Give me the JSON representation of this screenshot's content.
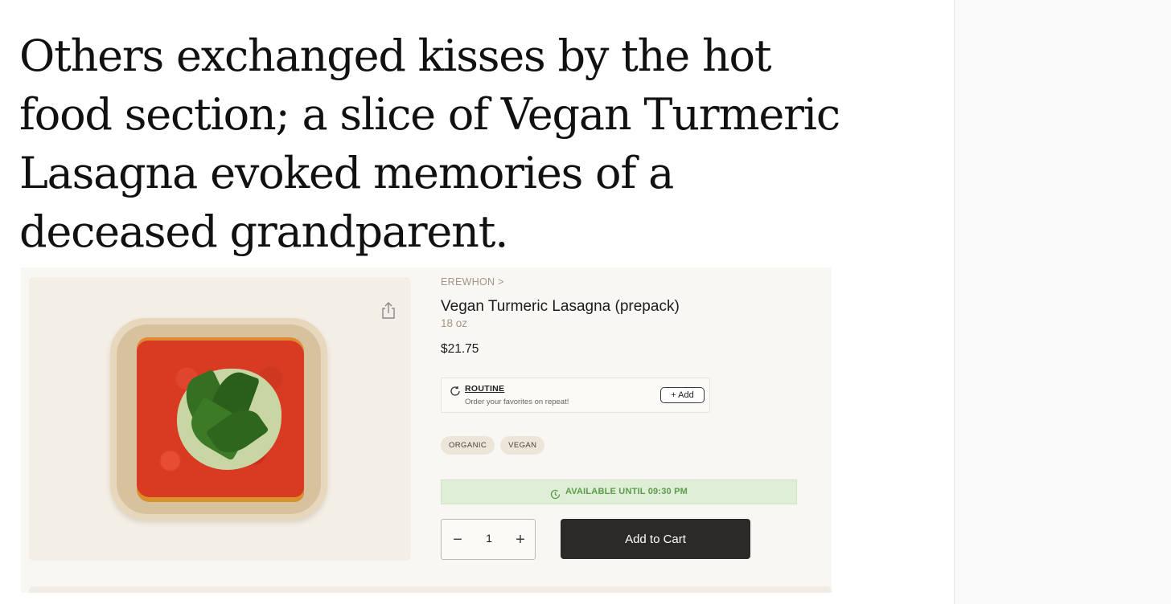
{
  "article": {
    "headline": "Others exchanged kisses by the hot food section; a slice of Vegan Turmeric Lasagna evoked memories of a deceased grandparent."
  },
  "product": {
    "brand_link": "EREWHON >",
    "title": "Vegan Turmeric Lasagna (prepack)",
    "size": "18 oz",
    "price": "$21.75",
    "routine": {
      "title": "ROUTINE",
      "subtitle": "Order your favorites on repeat!",
      "add_label": "+ Add"
    },
    "tags": [
      "ORGANIC",
      "VEGAN"
    ],
    "availability": "AVAILABLE UNTIL 09:30 PM",
    "quantity": "1",
    "minus_label": "−",
    "plus_label": "+",
    "add_to_cart_label": "Add to Cart"
  },
  "icons": {
    "share": "share-icon",
    "routine": "refresh-icon",
    "availability": "clock-icon"
  },
  "colors": {
    "availability_bg": "#dfeed6",
    "availability_text": "#5b9c4a",
    "add_to_cart_bg": "#2b2a28",
    "brand_muted": "#a59484"
  }
}
